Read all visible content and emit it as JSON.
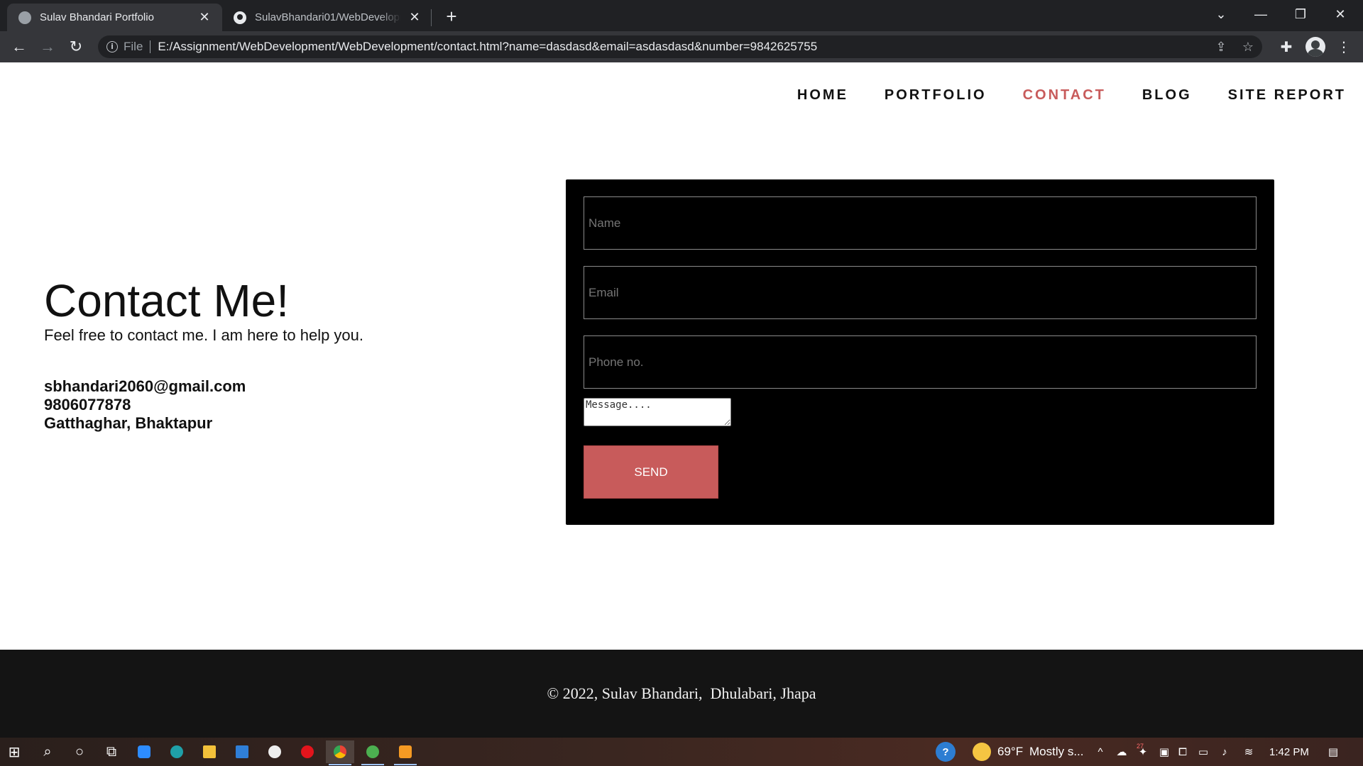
{
  "browser": {
    "tabs": [
      {
        "title": "Sulav Bhandari Portfolio",
        "favicon": "globe-icon",
        "active": true
      },
      {
        "title": "SulavBhandari01/WebDevelopment",
        "favicon": "github-icon",
        "active": false
      }
    ],
    "address": {
      "scheme_label": "File",
      "url": "E:/Assignment/WebDevelopment/WebDevelopment/contact.html?name=dasdasd&email=asdasdasd&number=9842625755"
    }
  },
  "site": {
    "nav": [
      {
        "label": "HOME",
        "active": false
      },
      {
        "label": "PORTFOLIO",
        "active": false
      },
      {
        "label": "CONTACT",
        "active": true
      },
      {
        "label": "BLOG",
        "active": false
      },
      {
        "label": "SITE REPORT",
        "active": false
      }
    ],
    "contact": {
      "heading": "Contact Me!",
      "lead": "Feel free to contact me. I am here to help you.",
      "email": "sbhandari2060@gmail.com",
      "phone": "9806077878",
      "address": "Gatthaghar, Bhaktapur"
    },
    "form": {
      "name_placeholder": "Name",
      "email_placeholder": "Email",
      "phone_placeholder": "Phone no.",
      "message_placeholder": "Message....",
      "send_label": "SEND"
    },
    "footer": "© 2022, Sulav Bhandari,  Dhulabari, Jhapa"
  },
  "taskbar": {
    "weather_temp": "69°F",
    "weather_desc": "Mostly s...",
    "clock": "1:42 PM",
    "badge": "27"
  },
  "colors": {
    "accent": "#c85b5b",
    "form_bg": "#000000",
    "footer_bg": "#141414"
  }
}
